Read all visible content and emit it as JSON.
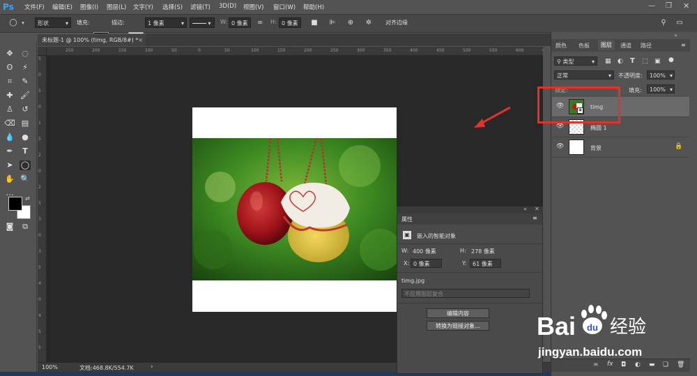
{
  "menubar": {
    "logo": "Ps",
    "items": [
      "文件(F)",
      "编辑(E)",
      "图像(I)",
      "图层(L)",
      "文字(Y)",
      "选择(S)",
      "滤镜(T)",
      "3D(D)",
      "视图(V)",
      "窗口(W)",
      "帮助(H)"
    ]
  },
  "options": {
    "mode": "形状",
    "fill_label": "填充:",
    "stroke_label": "描边:",
    "stroke_width": "1 像素",
    "w_label": "W:",
    "w_value": "0 像素",
    "h_label": "H:",
    "h_value": "0 像素",
    "align_edges": "对齐边缘"
  },
  "document": {
    "tab_title": "未标题-1 @ 100% (timg, RGB/8#) *",
    "close": "×",
    "zoom": "100%",
    "doc_size": "文档:468.8K/554.7K",
    "ruler_h": [
      "250",
      "200",
      "150",
      "100",
      "50",
      "0",
      "50",
      "100",
      "150",
      "200",
      "250",
      "300",
      "350",
      "400",
      "450",
      "500",
      "550",
      "600",
      "650"
    ],
    "ruler_v": [
      "5",
      "0",
      "5",
      "0",
      "1",
      "5",
      "2",
      "0",
      "2",
      "5",
      "3",
      "0",
      "3",
      "5",
      "4",
      "0",
      "4",
      "5",
      "5"
    ]
  },
  "properties": {
    "title": "属性",
    "type": "嵌入的智能对象",
    "w_label": "W:",
    "w_value": "400 像素",
    "h_label": "H:",
    "h_value": "278 像素",
    "x_label": "X:",
    "x_value": "0 像素",
    "y_label": "Y:",
    "y_value": "61 像素",
    "filename": "timg.jpg",
    "comp_placeholder": "不应用图层复合",
    "edit_button": "编辑内容",
    "convert_button": "转换为链接对象..."
  },
  "right_panel": {
    "tabs": [
      "颜色",
      "色板",
      "图层",
      "通道",
      "路径"
    ],
    "filter_kind": "类型",
    "blend_mode": "正常",
    "opacity_label": "不透明度:",
    "opacity_value": "100%",
    "lock_label": "锁定:",
    "fill_label": "填充:",
    "fill_value": "100%",
    "layers": [
      {
        "name": "timg"
      },
      {
        "name": "椭圆 1"
      },
      {
        "name": "背景"
      }
    ]
  },
  "watermark": {
    "brand": "Bai",
    "brand2": "经验",
    "url": "jingyan.baidu.com"
  },
  "colors": {
    "accent_red": "#e0332f",
    "ps_blue": "#31a8ff",
    "baidu_blue": "#2d55c8"
  }
}
